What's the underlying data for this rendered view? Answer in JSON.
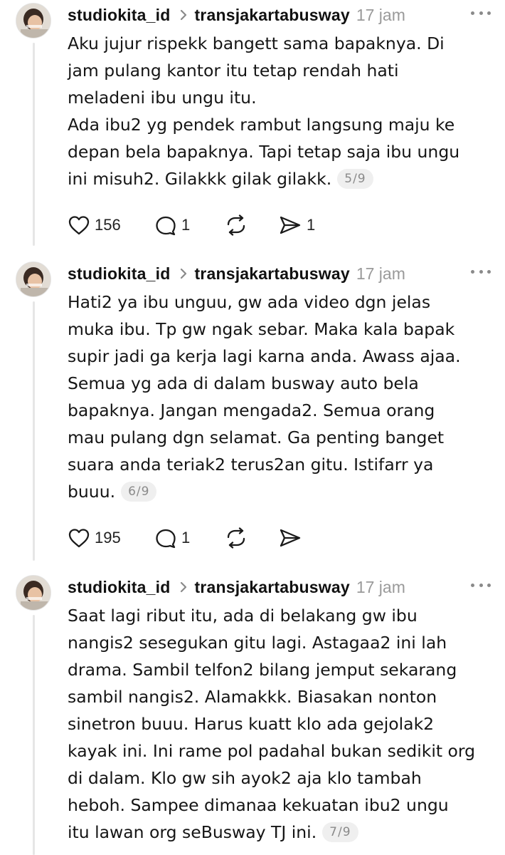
{
  "posts": [
    {
      "username": "studiokita_id",
      "reply_to": "transjakartabusway",
      "time": "17 jam",
      "lines": [
        "Aku jujur rispekk bangett sama bapaknya. Di",
        "jam pulang kantor itu tetap rendah hati",
        "meladeni ibu ungu itu.",
        "Ada ibu2 yg pendek rambut langsung maju ke",
        "depan bela bapaknya. Tapi tetap saja ibu ungu",
        "ini misuh2. Gilakkk gilak gilakk."
      ],
      "counter": "5/9",
      "likes": "156",
      "replies": "1",
      "shares": "1"
    },
    {
      "username": "studiokita_id",
      "reply_to": "transjakartabusway",
      "time": "17 jam",
      "lines": [
        "Hati2 ya ibu unguu,  gw ada video dgn jelas",
        "muka ibu. Tp gw ngak sebar. Maka kala bapak",
        "supir jadi ga kerja lagi karna anda. Awass ajaa.",
        "Semua yg ada di dalam busway auto bela",
        "bapaknya. Jangan mengada2. Semua orang",
        "mau pulang dgn selamat. Ga penting banget",
        "suara anda teriak2 terus2an gitu. Istifarr ya",
        "buuu."
      ],
      "counter": "6/9",
      "likes": "195",
      "replies": "1",
      "shares": ""
    },
    {
      "username": "studiokita_id",
      "reply_to": "transjakartabusway",
      "time": "17 jam",
      "lines": [
        "Saat lagi ribut itu, ada di belakang gw ibu",
        "nangis2 sesegukan gitu lagi. Astagaa2 ini lah",
        "drama. Sambil telfon2 bilang jemput sekarang",
        "sambil nangis2. Alamakkk. Biasakan nonton",
        "sinetron buuu. Harus kuatt klo ada gejolak2",
        "kayak ini. Ini rame pol padahal bukan sedikit org",
        "di dalam. Klo gw sih ayok2 aja klo tambah",
        "heboh. Sampee dimanaa kekuatan ibu2 ungu",
        "itu lawan org seBusway TJ ini."
      ],
      "counter": "7/9"
    }
  ],
  "icons": {
    "like": "heart-icon",
    "reply": "comment-icon",
    "repost": "repost-icon",
    "share": "send-icon",
    "reply_arrow": "chevron-right-icon",
    "more": "more-options-icon"
  },
  "colors": {
    "text": "#111111",
    "muted": "#9a9a9a",
    "thread_line": "#e6e6e6",
    "badge_bg": "#efefef"
  }
}
